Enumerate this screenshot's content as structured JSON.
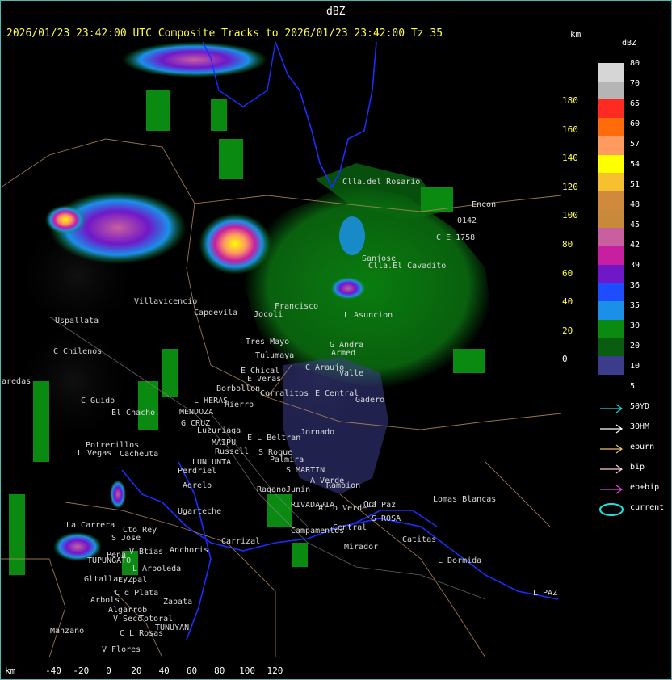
{
  "header": {
    "unit_title": "dBZ"
  },
  "title": "2026/01/23 23:42:00 UTC Composite Tracks to 2026/01/23 23:42:00 Tz 35",
  "axes": {
    "km_top": "km",
    "km_bottom": "km",
    "y_ticks": [
      "180",
      "160",
      "140",
      "120",
      "100",
      "80",
      "60",
      "40",
      "20",
      "0"
    ],
    "x_ticks": [
      "-40",
      "-20",
      "0",
      "20",
      "40",
      "60",
      "80",
      "100",
      "120"
    ]
  },
  "legend": {
    "title": "dBZ",
    "levels": [
      {
        "label": "80",
        "color": "#d6d6d6"
      },
      {
        "label": "70",
        "color": "#b5b5b5"
      },
      {
        "label": "65",
        "color": "#ff2a22"
      },
      {
        "label": "60",
        "color": "#ff6a0a"
      },
      {
        "label": "57",
        "color": "#ff9a60"
      },
      {
        "label": "54",
        "color": "#ffff00"
      },
      {
        "label": "51",
        "color": "#f7c02e"
      },
      {
        "label": "48",
        "color": "#d08a3c"
      },
      {
        "label": "45",
        "color": "#c88a3a"
      },
      {
        "label": "42",
        "color": "#c860a0"
      },
      {
        "label": "39",
        "color": "#c81ea0"
      },
      {
        "label": "36",
        "color": "#7018c8"
      },
      {
        "label": "35",
        "color": "#1e4cff"
      },
      {
        "label": "30",
        "color": "#1a90e8"
      },
      {
        "label": "20",
        "color": "#0a8a10"
      },
      {
        "label": "10",
        "color": "#0a5c10"
      },
      {
        "label": "5",
        "color": "#3c3c8c"
      }
    ],
    "tracks": [
      {
        "label": "50YD",
        "color": "#22d0d0"
      },
      {
        "label": "30HM",
        "color": "#ffffff"
      },
      {
        "label": "eburn",
        "color": "#e8c070"
      },
      {
        "label": "bip",
        "color": "#ffc8d8"
      },
      {
        "label": "eb+bip",
        "color": "#e040e0"
      },
      {
        "label": "current",
        "color": "#22e0e0"
      }
    ]
  },
  "places": [
    {
      "name": "Clla.del Rosario"
    },
    {
      "name": "Encon"
    },
    {
      "name": "Sanjose"
    },
    {
      "name": "Clla.El Cavadito"
    },
    {
      "name": "L Asuncion"
    },
    {
      "name": "Villavicencio"
    },
    {
      "name": "Uspallata"
    },
    {
      "name": "Capdevila"
    },
    {
      "name": "Jocoli"
    },
    {
      "name": "Francisco"
    },
    {
      "name": "Tres Mayo"
    },
    {
      "name": "Tulumaya"
    },
    {
      "name": "C Chilenos"
    },
    {
      "name": "G Andra"
    },
    {
      "name": "Armed"
    },
    {
      "name": "E Chical"
    },
    {
      "name": "E Veras"
    },
    {
      "name": "C Araujo"
    },
    {
      "name": "Valle"
    },
    {
      "name": "Borbollon"
    },
    {
      "name": "Corralitos"
    },
    {
      "name": "E Central"
    },
    {
      "name": "Gadero"
    },
    {
      "name": "L HERAS"
    },
    {
      "name": "El Chacho"
    },
    {
      "name": "MENDOZA"
    },
    {
      "name": "Hierro"
    },
    {
      "name": "C Guido"
    },
    {
      "name": "G CRUZ"
    },
    {
      "name": "Luzuriaga"
    },
    {
      "name": "E L Beltran"
    },
    {
      "name": "Jornado"
    },
    {
      "name": "Potrerillos"
    },
    {
      "name": "Cacheuta"
    },
    {
      "name": "L Vegas"
    },
    {
      "name": "MAIPU"
    },
    {
      "name": "Russell"
    },
    {
      "name": "LUNLUNTA"
    },
    {
      "name": "S Roque"
    },
    {
      "name": "Palmira"
    },
    {
      "name": "Perdriel"
    },
    {
      "name": "S MARTIN"
    },
    {
      "name": "Agrelo"
    },
    {
      "name": "A Verde"
    },
    {
      "name": "Rambion"
    },
    {
      "name": "Ragano"
    },
    {
      "name": "Junin"
    },
    {
      "name": "La Paz"
    },
    {
      "name": "Ugarteche"
    },
    {
      "name": "RIVADAVIA"
    },
    {
      "name": "Alto Verde"
    },
    {
      "name": "Oct"
    },
    {
      "name": "Lomas Blancas"
    },
    {
      "name": "S ROSA"
    },
    {
      "name": "Catitas"
    },
    {
      "name": "La Carrera"
    },
    {
      "name": "Cto Rey"
    },
    {
      "name": "S Jose"
    },
    {
      "name": "Carrizal"
    },
    {
      "name": "Campamentos"
    },
    {
      "name": "Central"
    },
    {
      "name": "Anchoris"
    },
    {
      "name": "V Btias"
    },
    {
      "name": "TUPUNGATO"
    },
    {
      "name": "Pena"
    },
    {
      "name": "Mirador"
    },
    {
      "name": "L Dormida"
    },
    {
      "name": "L Arboleda"
    },
    {
      "name": "Gltallary"
    },
    {
      "name": "E Zpal"
    },
    {
      "name": "C d Plata"
    },
    {
      "name": "L Arbols"
    },
    {
      "name": "Zapata"
    },
    {
      "name": "Algarrob"
    },
    {
      "name": "V Seco"
    },
    {
      "name": "Totoral"
    },
    {
      "name": "TUNUYAN"
    },
    {
      "name": "Manzano"
    },
    {
      "name": "C L Rosas"
    },
    {
      "name": "V Flores"
    },
    {
      "name": "L PAZ"
    },
    {
      "name": "aredas"
    },
    {
      "name": "0142"
    },
    {
      "name": "C E 1758"
    }
  ]
}
